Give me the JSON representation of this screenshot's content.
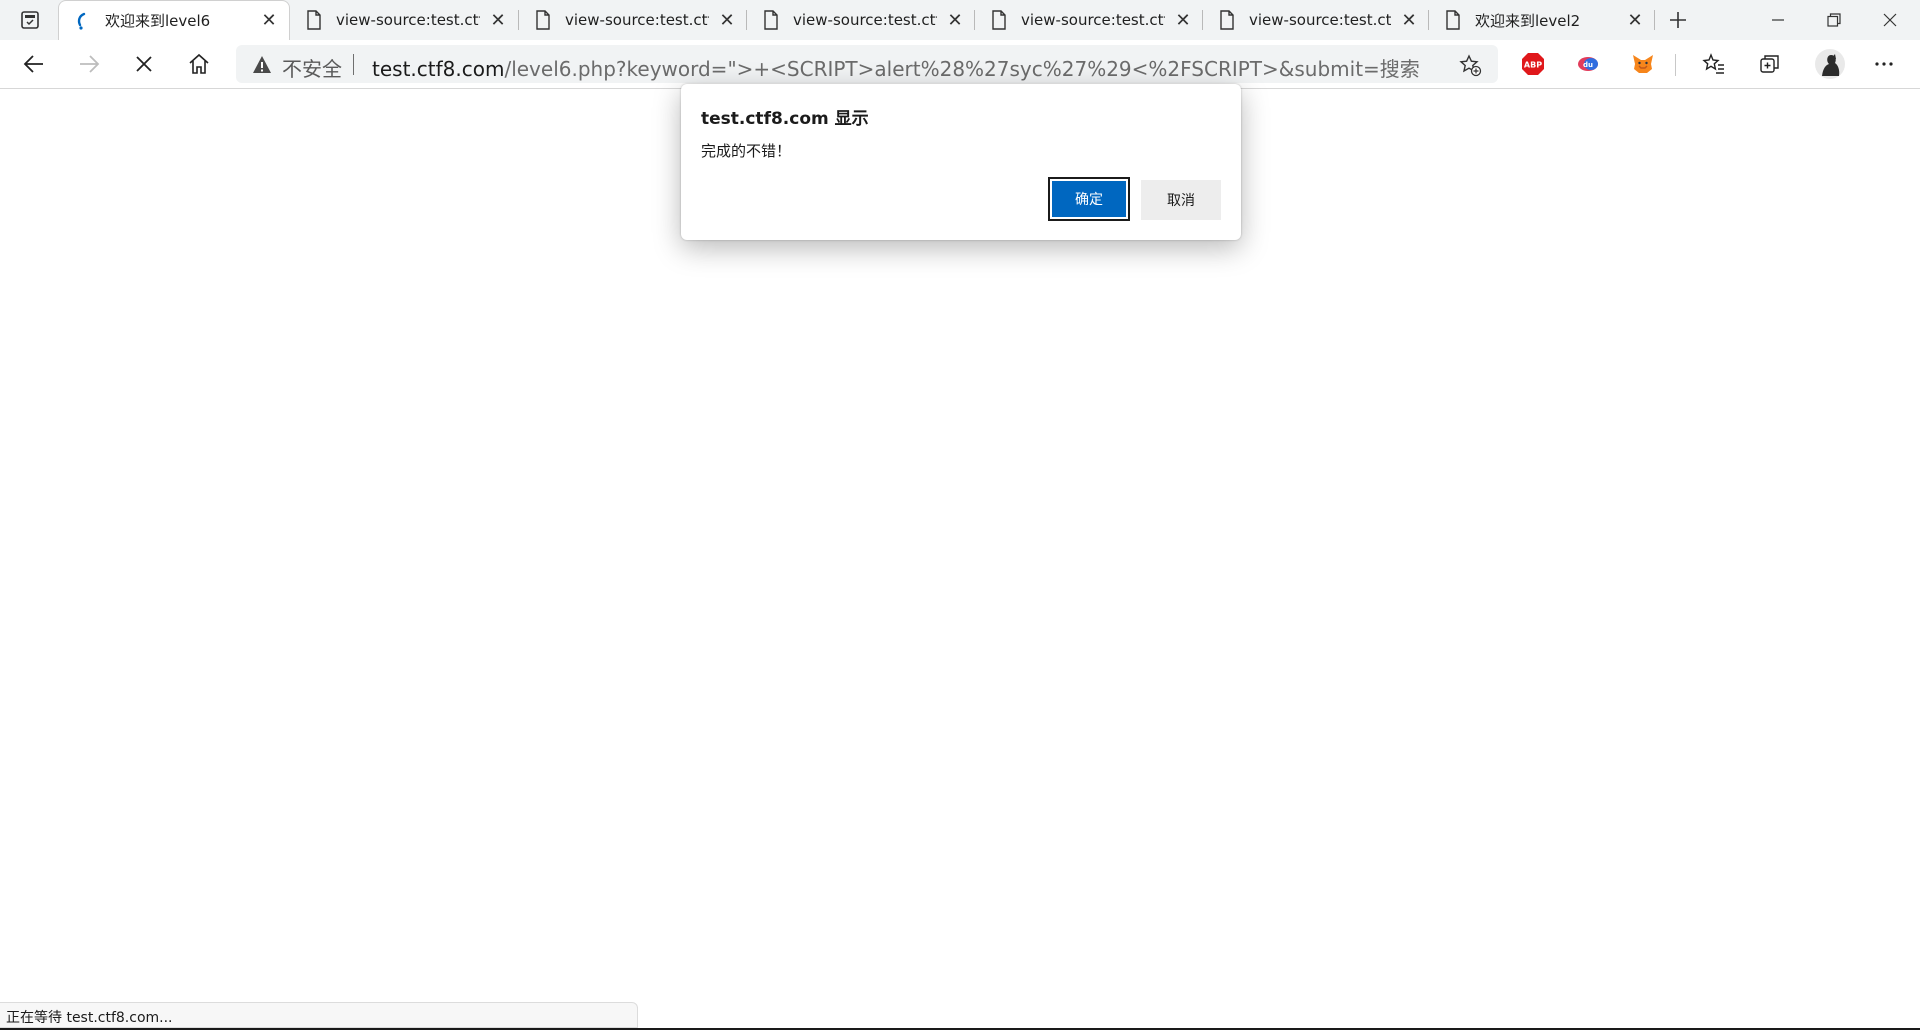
{
  "tabs": [
    {
      "title": "欢迎来到level6",
      "active": true,
      "favicon": "loading-spinner-icon"
    },
    {
      "title": "view-source:test.ctf8.c",
      "active": false,
      "favicon": "page-icon"
    },
    {
      "title": "view-source:test.ctf8.c",
      "active": false,
      "favicon": "page-icon"
    },
    {
      "title": "view-source:test.ctf8.c",
      "active": false,
      "favicon": "page-icon"
    },
    {
      "title": "view-source:test.ctf8.c",
      "active": false,
      "favicon": "page-icon"
    },
    {
      "title": "view-source:test.ctf8.c",
      "active": false,
      "favicon": "page-icon"
    },
    {
      "title": "欢迎来到level2",
      "active": false,
      "favicon": "page-icon"
    }
  ],
  "address": {
    "insecure_label": "不安全",
    "url_host": "test.ctf8.com",
    "url_rest": "/level6.php?keyword=\">+<SCRIPT>alert%28%27syc%27%29<%2FSCRIPT>&submit=搜索"
  },
  "extensions": [
    "adblock-plus-icon",
    "extension-du-icon",
    "metamask-fox-icon"
  ],
  "dialog": {
    "title": "test.ctf8.com 显示",
    "message": "完成的不错！",
    "ok_label": "确定",
    "cancel_label": "取消"
  },
  "status": {
    "text": "正在等待 test.ctf8.com..."
  },
  "colors": {
    "accent": "#0067c0",
    "tabstrip_bg": "#f1f3f4"
  }
}
